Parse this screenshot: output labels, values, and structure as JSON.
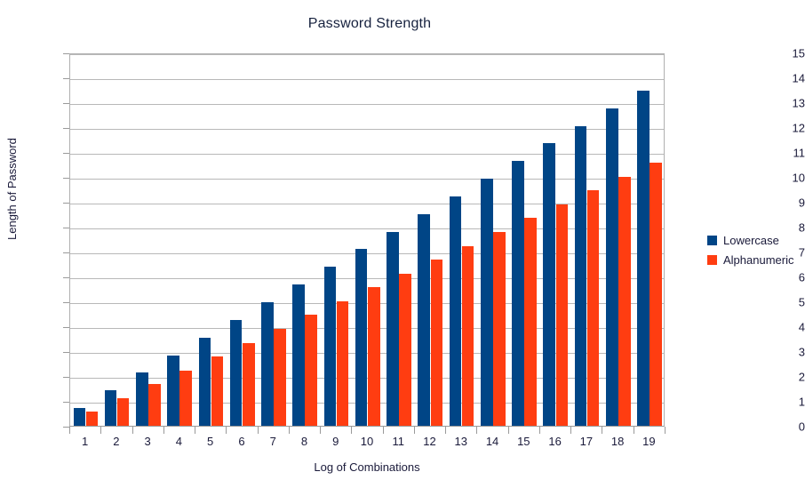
{
  "chart_data": {
    "type": "bar",
    "title": "Password Strength",
    "xlabel": "Log of Combinations",
    "ylabel": "Length of Password",
    "categories": [
      "1",
      "2",
      "3",
      "4",
      "5",
      "6",
      "7",
      "8",
      "9",
      "10",
      "11",
      "12",
      "13",
      "14",
      "15",
      "16",
      "17",
      "18",
      "19"
    ],
    "series": [
      {
        "name": "Lowercase",
        "color": "#004586",
        "values": [
          0.71,
          1.42,
          2.13,
          2.83,
          3.54,
          4.25,
          4.96,
          5.67,
          6.38,
          7.09,
          7.79,
          8.5,
          9.21,
          9.92,
          10.63,
          11.34,
          12.04,
          12.75,
          13.46
        ]
      },
      {
        "name": "Alphanumeric",
        "color": "#ff3d11",
        "values": [
          0.56,
          1.11,
          1.67,
          2.22,
          2.78,
          3.33,
          3.89,
          4.45,
          5.0,
          5.56,
          6.11,
          6.67,
          7.22,
          7.78,
          8.34,
          8.89,
          9.45,
          10.0,
          10.56
        ]
      }
    ],
    "ylim": [
      0,
      15
    ],
    "yticks": [
      0,
      1,
      2,
      3,
      4,
      5,
      6,
      7,
      8,
      9,
      10,
      11,
      12,
      13,
      14,
      15
    ],
    "grid": true,
    "legend_position": "right"
  },
  "legend": {
    "items": [
      {
        "label": "Lowercase",
        "color": "#004586"
      },
      {
        "label": "Alphanumeric",
        "color": "#ff3d11"
      }
    ]
  }
}
